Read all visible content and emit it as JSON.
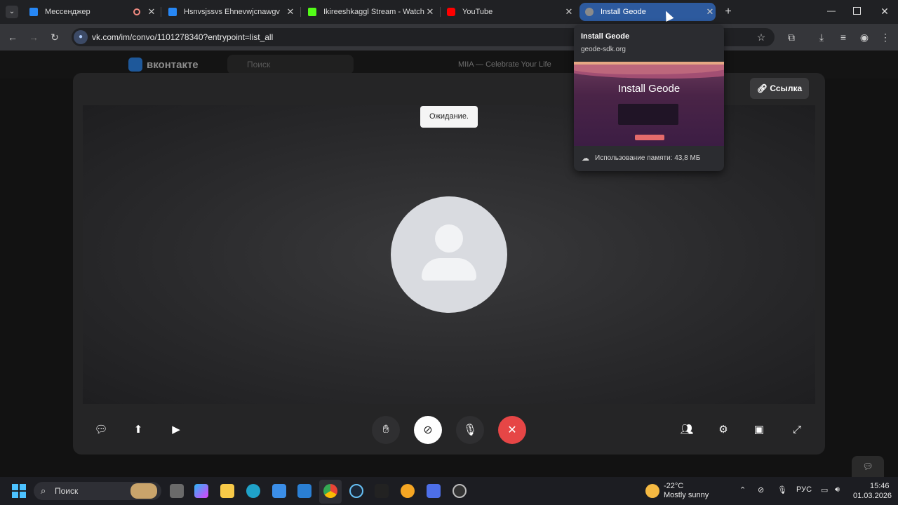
{
  "browser": {
    "tabs": [
      {
        "title": "Мессенджер",
        "favicon_color": "#2787f5"
      },
      {
        "title": "Hsnvsjssvs Ehnevwjcnawgv",
        "favicon_color": "#2787f5"
      },
      {
        "title": "Ikireeshkaggl Stream - Watch Li",
        "favicon_color": "#53fc18"
      },
      {
        "title": "YouTube",
        "favicon_color": "#ff0000"
      },
      {
        "title": "Install Geode",
        "favicon_color": "#8a8a8a"
      }
    ],
    "url": "vk.com/im/convo/1101278340?entrypoint=list_all",
    "hover_card": {
      "title": "Install Geode",
      "domain": "geode-sdk.org",
      "thumbnail_heading": "Install Geode",
      "memory": "Использование памяти: 43,8 МБ"
    }
  },
  "vk": {
    "logo": "вконтакте",
    "search_placeholder": "Поиск",
    "now_playing": "MIIA — Celebrate Your Life"
  },
  "call": {
    "status": "Ожидание.",
    "link_button": "Ссылка"
  },
  "taskbar": {
    "search_label": "Поиск",
    "weather_temp": "-22°C",
    "weather_desc": "Mostly sunny",
    "language": "РУС",
    "time": "15:46",
    "date": "01.03.2026"
  },
  "colors": {
    "active_tab": "#2d5a9e",
    "end_call": "#e64646",
    "vk_blue": "#2787f5"
  }
}
